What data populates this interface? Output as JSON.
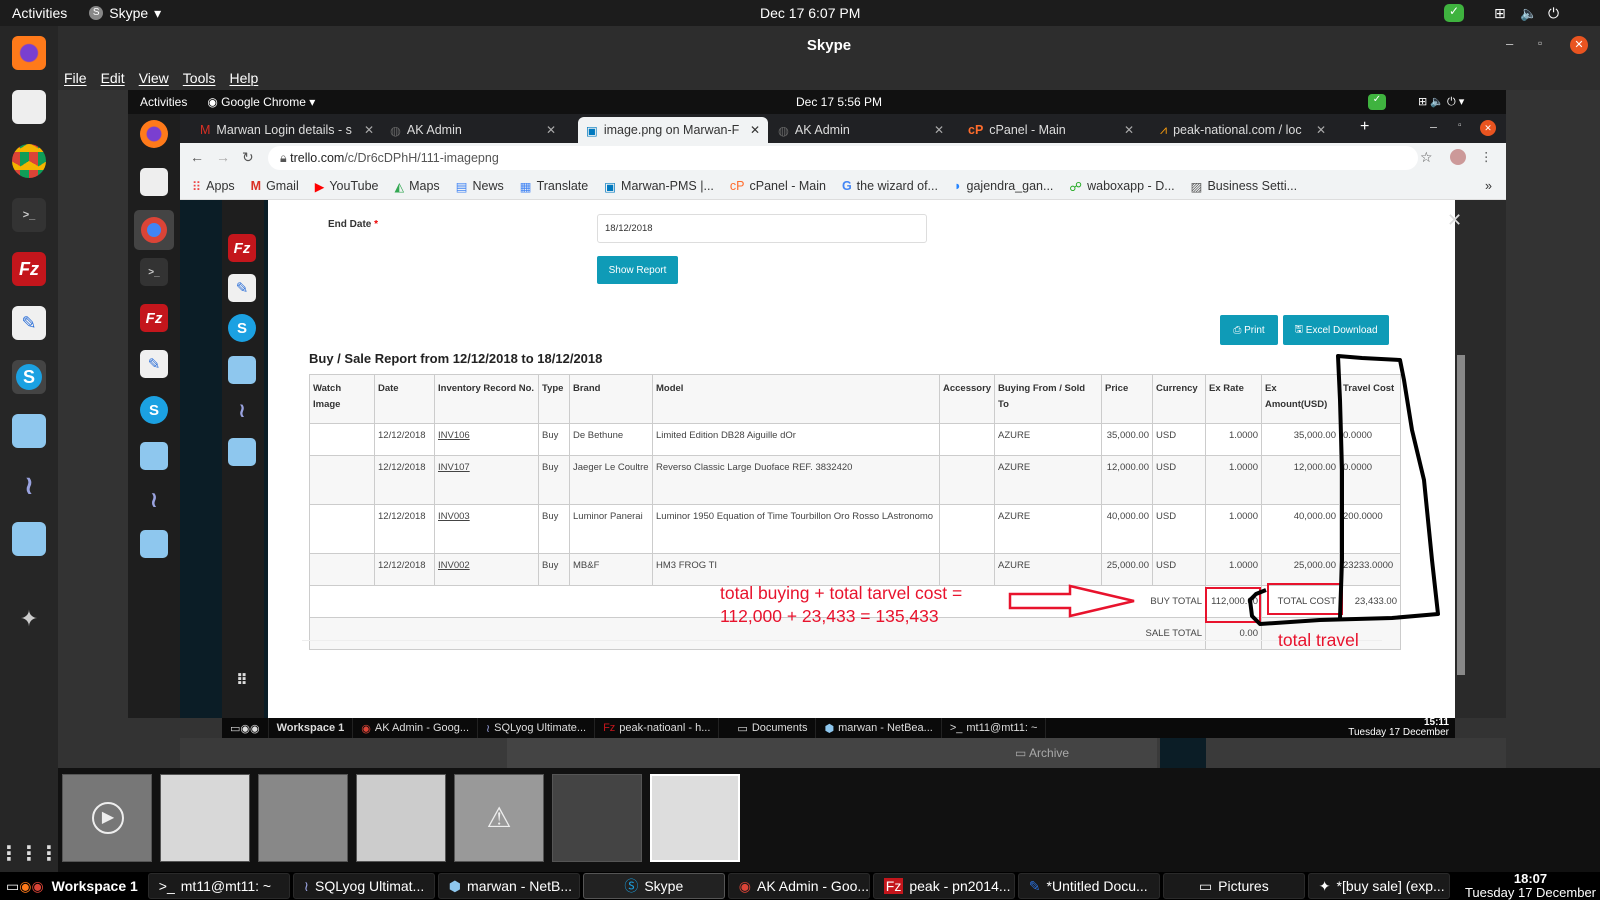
{
  "top_bar": {
    "activities": "Activities",
    "app_menu": "Skype",
    "clock": "Dec 17  6:07 PM"
  },
  "skype_window": {
    "title": "Skype",
    "menu": [
      "File",
      "Edit",
      "View",
      "Tools",
      "Help"
    ]
  },
  "nested": {
    "top_bar": {
      "activities": "Activities",
      "app_menu": "Google Chrome",
      "clock": "Dec 17  5:56 PM"
    },
    "tabs": [
      {
        "label": "Marwan Login details - s",
        "active": false
      },
      {
        "label": "AK Admin",
        "active": false
      },
      {
        "label": "image.png on Marwan-F",
        "active": true
      },
      {
        "label": "AK Admin",
        "active": false
      },
      {
        "label": "cPanel - Main",
        "active": false
      },
      {
        "label": "peak-national.com / loc",
        "active": false
      }
    ],
    "url_domain": "trello.com",
    "url_path": "/c/Dr6cDPhH/111-imagepng",
    "bookmarks": [
      "Apps",
      "Gmail",
      "YouTube",
      "Maps",
      "News",
      "Translate",
      "Marwan-PMS |...",
      "cPanel - Main",
      "the wizard of...",
      "gajendra_gan...",
      "waboxapp - D...",
      "Business Setti..."
    ],
    "form": {
      "end_date_label": "End Date",
      "required_mark": "*",
      "end_date_value": "18/12/2018",
      "show_report": "Show Report"
    },
    "actions": {
      "print": "Print",
      "excel": "Excel Download"
    },
    "report_title": "Buy / Sale Report from 12/12/2018 to 18/12/2018",
    "table": {
      "headers": [
        "Watch Image",
        "Date",
        "Inventory Record No.",
        "Type",
        "Brand",
        "Model",
        "Accessory",
        "Buying From / Sold To",
        "Price",
        "Currency",
        "Ex Rate",
        "Ex Amount(USD)",
        "Travel Cost"
      ],
      "rows": [
        [
          "",
          "12/12/2018",
          "INV106",
          "Buy",
          "De Bethune",
          "Limited Edition DB28 Aiguille dOr",
          "",
          "AZURE",
          "35,000.00",
          "USD",
          "1.0000",
          "35,000.00",
          "0.0000"
        ],
        [
          "",
          "12/12/2018",
          "INV107",
          "Buy",
          "Jaeger Le Coultre",
          "Reverso Classic Large Duoface REF. 3832420",
          "",
          "AZURE",
          "12,000.00",
          "USD",
          "1.0000",
          "12,000.00",
          "0.0000"
        ],
        [
          "",
          "12/12/2018",
          "INV003",
          "Buy",
          "Luminor Panerai",
          "Luminor 1950 Equation of Time Tourbillon Oro Rosso LAstronomo",
          "",
          "AZURE",
          "40,000.00",
          "USD",
          "1.0000",
          "40,000.00",
          "200.0000"
        ],
        [
          "",
          "12/12/2018",
          "INV002",
          "Buy",
          "MB&F",
          "HM3 FROG TI",
          "",
          "AZURE",
          "25,000.00",
          "USD",
          "1.0000",
          "25,000.00",
          "23233.0000"
        ]
      ],
      "buy_total_label": "BUY TOTAL",
      "buy_total": "112,000.00",
      "total_cost_label": "TOTAL COST",
      "total_cost": "23,433.00",
      "sale_total_label": "SALE TOTAL",
      "sale_total": "0.00"
    },
    "annotations": {
      "line1": "total buying + total tarvel cost =",
      "line2": "112,000 + 23,433 = 135,433",
      "travel": "total travel",
      "color": "#e8132d"
    },
    "taskbar": {
      "workspace": "Workspace 1",
      "items": [
        "AK Admin - Goog...",
        "SQLyog Ultimate...",
        "peak-natioanl - h...",
        "Documents",
        "marwan - NetBea...",
        "mt11@mt11: ~"
      ],
      "time": "15:11",
      "date": "Tuesday 17 December"
    },
    "below": {
      "archive": "Archive"
    }
  },
  "taskbar": {
    "workspace": "Workspace 1",
    "items": [
      "mt11@mt11: ~",
      "SQLyog Ultimat...",
      "marwan - NetB...",
      "Skype",
      "AK Admin - Goo...",
      "peak - pn2014...",
      "*Untitled Docu...",
      "Pictures",
      "*[buy sale] (exp..."
    ],
    "time": "18:07",
    "date": "Tuesday 17 December"
  },
  "colors": {
    "accent": "#0f9bb7",
    "annotation": "#e8132d"
  }
}
